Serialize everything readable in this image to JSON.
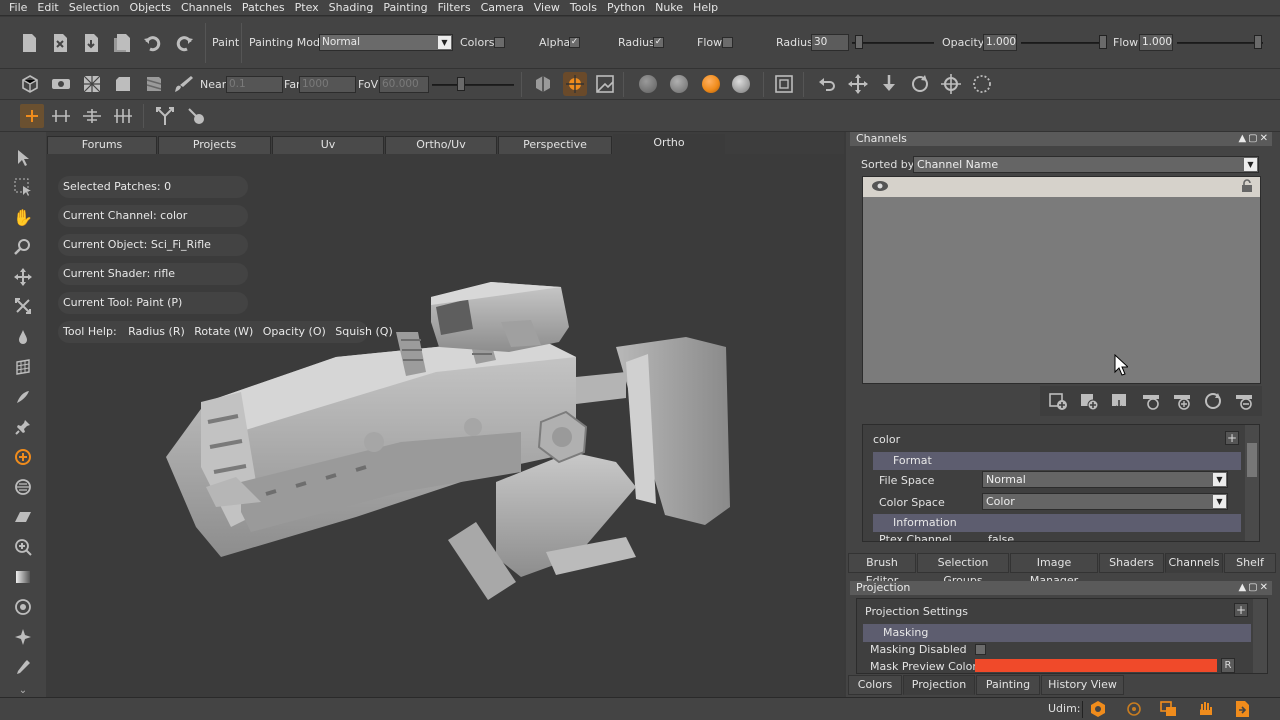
{
  "menu": [
    "File",
    "Edit",
    "Selection",
    "Objects",
    "Channels",
    "Patches",
    "Ptex",
    "Shading",
    "Painting",
    "Filters",
    "Camera",
    "View",
    "Tools",
    "Python",
    "Nuke",
    "Help"
  ],
  "toolbar1": {
    "paint_label": "Paint",
    "painting_mode_label": "Painting Mode",
    "painting_mode_value": "Normal",
    "colors_label": "Colors",
    "alpha_label": "Alpha",
    "radius_chk_label": "Radius",
    "flow_chk_label": "Flow",
    "radius_label": "Radius",
    "radius_value": "30",
    "opacity_label": "Opacity",
    "opacity_value": "1.000",
    "flow_label": "Flow",
    "flow_value": "1.000",
    "check_mark": "✓"
  },
  "toolbar2": {
    "near_label": "Near",
    "near_value": "0.1",
    "far_label": "Far",
    "far_value": "1000",
    "fov_label": "FoV",
    "fov_value": "60.000",
    "colors": {
      "sphere_orange": "#f08c1c",
      "sphere_grey": "#8a8a8a"
    }
  },
  "view_tabs": [
    "Forums",
    "Projects",
    "Uv",
    "Ortho/Uv",
    "Perspective",
    "Ortho"
  ],
  "active_view_tab": "Ortho",
  "hud": {
    "selected_patches": "Selected Patches: 0",
    "current_channel": "Current Channel: color",
    "current_object": "Current Object: Sci_Fi_Rifle",
    "current_shader": "Current Shader: rifle",
    "current_tool": "Current Tool: Paint (P)",
    "tool_help": "Tool Help:",
    "help_radius": "Radius (R)",
    "help_rotate": "Rotate (W)",
    "help_opacity": "Opacity (O)",
    "help_squish": "Squish (Q)"
  },
  "channels_panel": {
    "title": "Channels",
    "sorted_by_label": "Sorted by",
    "sorted_by_value": "Channel Name",
    "channel_name": "color",
    "format_group": "Format",
    "file_space_label": "File Space",
    "file_space_value": "Normal",
    "color_space_label": "Color Space",
    "color_space_value": "Color",
    "information_group": "Information",
    "ptex_channel_label": "Ptex Channel",
    "ptex_channel_value": "false",
    "tabs": [
      "Brush Editor",
      "Selection Groups",
      "Image Manager",
      "Shaders",
      "Channels",
      "Shelf"
    ],
    "active_tab": "Channels"
  },
  "projection_panel": {
    "title": "Projection",
    "settings_label": "Projection Settings",
    "masking_group": "Masking",
    "masking_disabled_label": "Masking Disabled",
    "mask_preview_label": "Mask Preview Color",
    "mask_color": "#f04a2a",
    "reset_label": "R",
    "tabs": [
      "Colors",
      "Projection",
      "Painting",
      "History View"
    ],
    "active_tab": "Projection"
  },
  "status": {
    "udim_label": "Udim:"
  }
}
